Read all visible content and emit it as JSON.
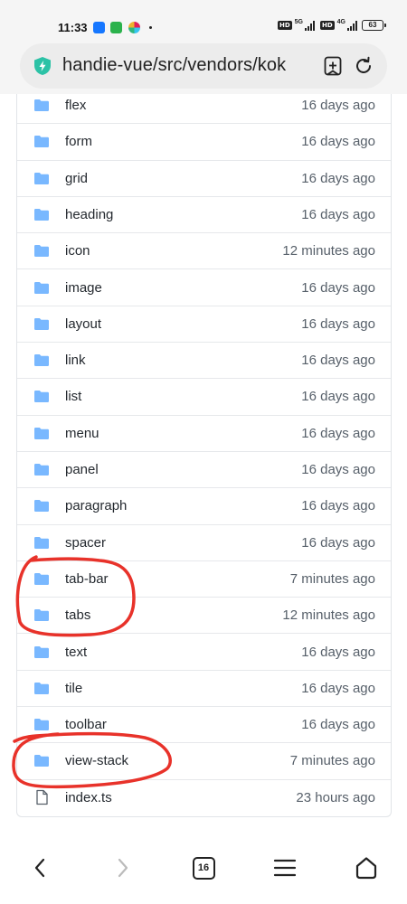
{
  "status_bar": {
    "time": "11:33",
    "network_1": "5G",
    "network_2": "4G",
    "hd_1": "HD",
    "hd_2": "HD",
    "battery": "63"
  },
  "address_bar": {
    "url": "handie-vue/src/vendors/kok",
    "security_icon": "shield-bolt-icon",
    "add_icon": "add-bookmark-icon",
    "refresh_icon": "refresh-icon"
  },
  "files": [
    {
      "name": "flex",
      "date": "16 days ago",
      "type": "folder"
    },
    {
      "name": "form",
      "date": "16 days ago",
      "type": "folder"
    },
    {
      "name": "grid",
      "date": "16 days ago",
      "type": "folder"
    },
    {
      "name": "heading",
      "date": "16 days ago",
      "type": "folder"
    },
    {
      "name": "icon",
      "date": "12 minutes ago",
      "type": "folder"
    },
    {
      "name": "image",
      "date": "16 days ago",
      "type": "folder"
    },
    {
      "name": "layout",
      "date": "16 days ago",
      "type": "folder"
    },
    {
      "name": "link",
      "date": "16 days ago",
      "type": "folder"
    },
    {
      "name": "list",
      "date": "16 days ago",
      "type": "folder"
    },
    {
      "name": "menu",
      "date": "16 days ago",
      "type": "folder"
    },
    {
      "name": "panel",
      "date": "16 days ago",
      "type": "folder"
    },
    {
      "name": "paragraph",
      "date": "16 days ago",
      "type": "folder"
    },
    {
      "name": "spacer",
      "date": "16 days ago",
      "type": "folder"
    },
    {
      "name": "tab-bar",
      "date": "7 minutes ago",
      "type": "folder"
    },
    {
      "name": "tabs",
      "date": "12 minutes ago",
      "type": "folder"
    },
    {
      "name": "text",
      "date": "16 days ago",
      "type": "folder"
    },
    {
      "name": "tile",
      "date": "16 days ago",
      "type": "folder"
    },
    {
      "name": "toolbar",
      "date": "16 days ago",
      "type": "folder"
    },
    {
      "name": "view-stack",
      "date": "7 minutes ago",
      "type": "folder"
    },
    {
      "name": "index.ts",
      "date": "23 hours ago",
      "type": "file"
    }
  ],
  "bottom_nav": {
    "back_icon": "chevron-left-icon",
    "forward_icon": "chevron-right-icon",
    "tab_count": "16",
    "menu_icon": "hamburger-menu-icon",
    "home_icon": "home-icon"
  },
  "colors": {
    "folder": "#79b8ff",
    "annotation": "#e8322a",
    "shield": "#2cc2a6"
  }
}
